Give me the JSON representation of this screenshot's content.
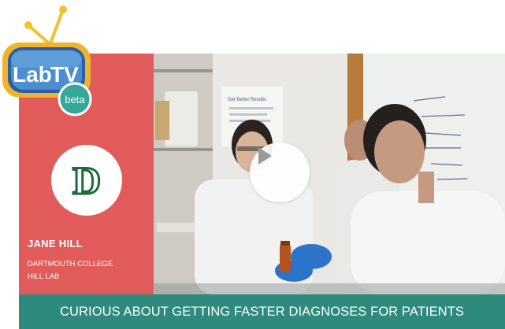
{
  "brand": {
    "logo_text_lab": "Lab",
    "logo_text_tv": "TV",
    "beta_label": "beta",
    "icon": "labtv-tv-logo"
  },
  "profile": {
    "name": "JANE HILL",
    "institution": "DARTMOUTH COLLEGE",
    "lab": "HILL LAB",
    "logo_letter": "D",
    "logo_icon": "dartmouth-d-logo",
    "panel_color": "#e25b5b",
    "logo_color": "#1f6b3a"
  },
  "video": {
    "play_icon": "play-icon",
    "poster_sign_text": "Get Better Results"
  },
  "caption": {
    "text": "CURIOUS ABOUT GETTING FASTER DIAGNOSES FOR PATIENTS",
    "bar_color": "#2f8a7e"
  }
}
